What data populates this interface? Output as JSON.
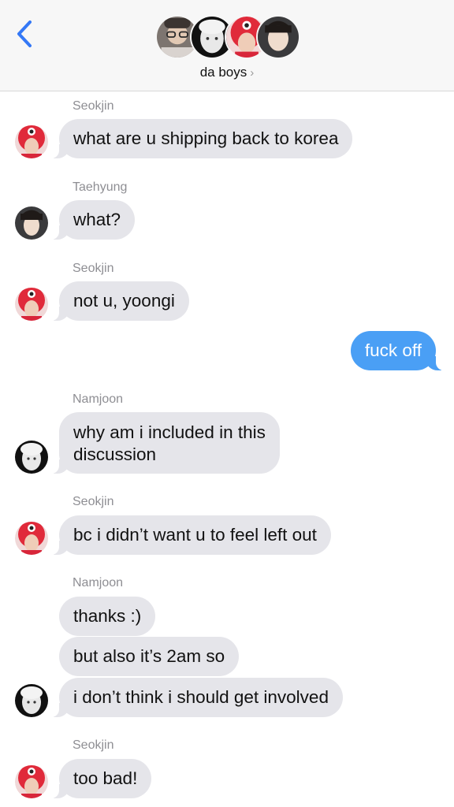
{
  "header": {
    "back_icon": "chevron-left-icon",
    "title": "da boys",
    "title_chevron": "›",
    "accent_color": "#3478f6"
  },
  "colors": {
    "incoming_bubble": "#e5e5ea",
    "outgoing_bubble": "#4a9ff5"
  },
  "messages": [
    {
      "sender": "Seokjin",
      "text": "what are u shipping back to korea"
    },
    {
      "sender": "Taehyung",
      "text": "what?"
    },
    {
      "sender": "Seokjin",
      "text": "not u, yoongi"
    },
    {
      "sender": "me",
      "text": "fuck off"
    },
    {
      "sender": "Namjoon",
      "text_lines": [
        "why am i included in this",
        "discussion"
      ]
    },
    {
      "sender": "Seokjin",
      "text": "bc i didn’t want u to feel left out"
    },
    {
      "sender": "Namjoon",
      "text": "thanks :)"
    },
    {
      "sender": "Namjoon",
      "text": "but also it’s 2am so"
    },
    {
      "sender": "Namjoon",
      "text": "i don’t think i should get involved"
    },
    {
      "sender": "Seokjin",
      "text": "too bad!"
    }
  ]
}
